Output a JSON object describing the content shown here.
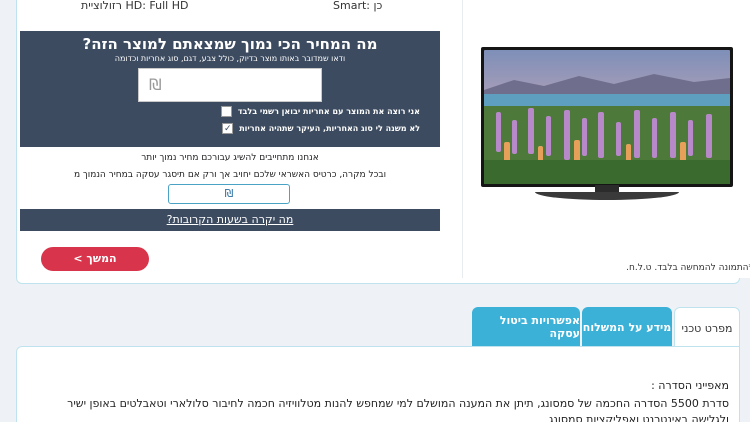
{
  "specs": {
    "resolution": "רזולוציית HD: Full HD",
    "smart": "Smart: כן"
  },
  "price_form": {
    "title": "מה המחיר הכי נמוך שמצאתם למוצר הזה?",
    "subtitle": "ודאו שמדובר באותו מוצר בדיוק, כולל צבע, דגם, סוג אחריות וכדומה",
    "currency_symbol": "₪",
    "checkbox_official_label": "אני רוצה את המוצר עם אחריות יבואן רשמי בלבד",
    "checkbox_official_checked": false,
    "checkbox_any_label": "לא משנה לי סוג האחריות, העיקר שתהיה אחריות",
    "checkbox_any_checked": true,
    "checkmark": "✓"
  },
  "promise": {
    "line1": "אנחנו מתחייבים להשיג עבורכם מחיר נמוך יותר",
    "line2": "ובכל מקרה, כרטיס האשראי שלכם יחויב אך ורק אם תיסגר עסקה במחיר הנמוך מ"
  },
  "pay_button_label": "₪",
  "why_link": "מה יקרה בשעות הקרובות?",
  "continue_button": "המשך >",
  "image_caption": "*התמונה להמחשה בלבד. ט.ל.ח.",
  "tabs": [
    {
      "label": "מפרט טכני",
      "active": true
    },
    {
      "label": "מידע על המשלוח",
      "active": false
    },
    {
      "label": "אפשרויות ביטול עסקה",
      "active": false
    }
  ],
  "description": {
    "heading": "מאפייני הסדרה :",
    "line1": "סדרת 5500 הסדרה החכמה של סמסונג, תיתן את המענה המושלם למי שמחפש להנות מטלוויזיה חכמה לחיבור סלולארי וטאבלטים באופן ישיר",
    "line2": "ולגלישה באינטרנט ואפליקציות סמסונג"
  },
  "colors": {
    "panel_dark": "#3c4b60",
    "accent_blue": "#3bb1d8",
    "cta_red": "#d8344b"
  }
}
